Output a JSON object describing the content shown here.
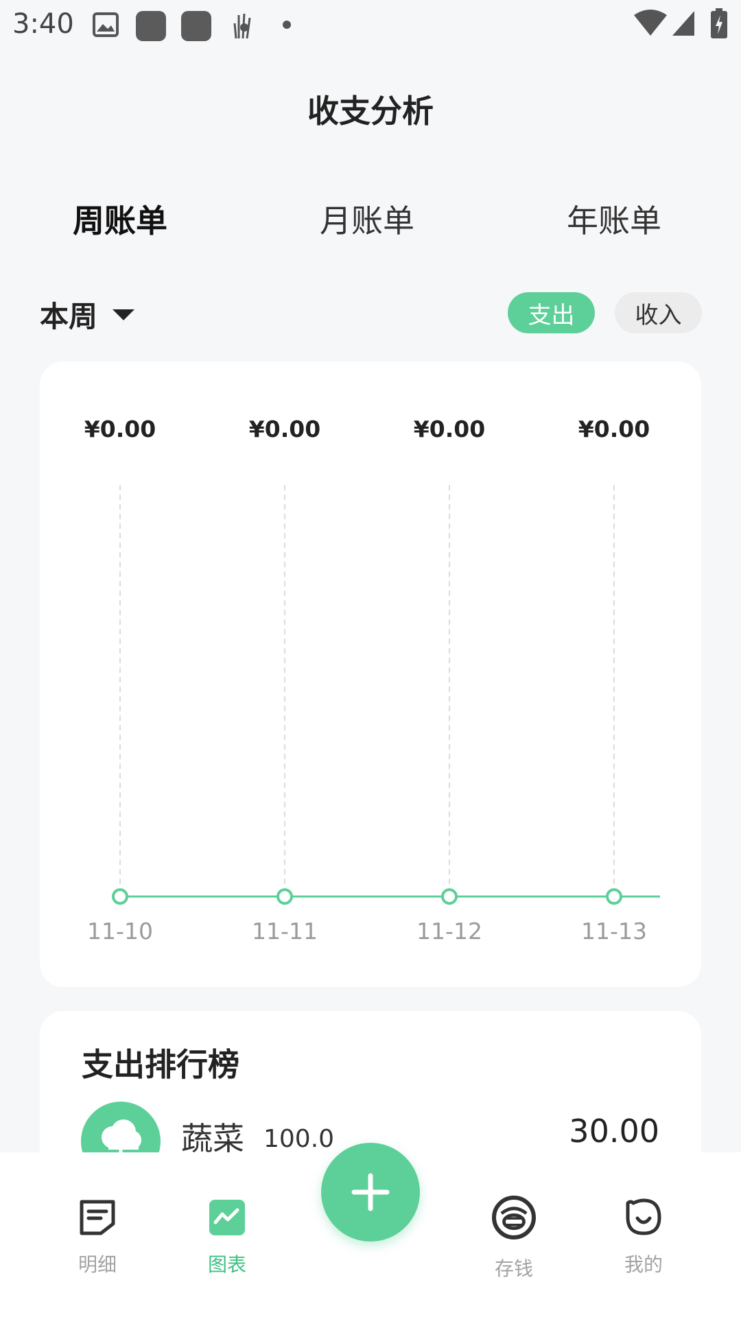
{
  "status_bar": {
    "time": "3:40"
  },
  "header": {
    "title": "收支分析"
  },
  "tabs": [
    {
      "label": "周账单"
    },
    {
      "label": "月账单"
    },
    {
      "label": "年账单"
    }
  ],
  "period": {
    "label": "本周"
  },
  "toggle": {
    "expense_label": "支出",
    "income_label": "收入"
  },
  "colors": {
    "accent": "#5dcf98",
    "accent_dark": "#3fbf82"
  },
  "chart_data": {
    "type": "line",
    "categories": [
      "11-10",
      "11-11",
      "11-12",
      "11-13"
    ],
    "values": [
      0,
      0,
      0,
      0
    ],
    "value_labels": [
      "¥0.00",
      "¥0.00",
      "¥0.00",
      "¥0.00"
    ],
    "title": "",
    "xlabel": "",
    "ylabel": ""
  },
  "ranking": {
    "title": "支出排行榜",
    "items": [
      {
        "name": "蔬菜",
        "percent": "100.0",
        "amount": "30.00",
        "icon": "vegetable-icon"
      }
    ]
  },
  "bottom_nav": {
    "items": [
      {
        "label": "明细",
        "icon": "detail-icon"
      },
      {
        "label": "图表",
        "icon": "chart-icon"
      },
      {
        "label": "存钱",
        "icon": "savings-icon"
      },
      {
        "label": "我的",
        "icon": "profile-icon"
      }
    ],
    "fab_icon": "plus-icon"
  }
}
